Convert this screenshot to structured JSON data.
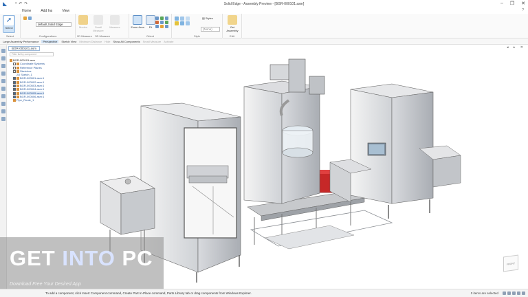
{
  "window": {
    "title": "Solid Edge - Assembly Preview - [BGR-000101.asm]",
    "controls": [
      "–",
      "❐",
      "✕"
    ]
  },
  "menu": {
    "items": [
      "Home",
      "Add Ins",
      "View"
    ],
    "help": "?"
  },
  "ribbon": {
    "select": {
      "label": "Select",
      "group": "Select"
    },
    "configurations": {
      "combo_value": "default,Solid Edge",
      "group": "Configurations"
    },
    "measure": {
      "small_label": "Small Measure",
      "measure_label": "Measure",
      "modes_label": "Modes",
      "measure_2d": "2D Measure",
      "measure_3d": "3D Measure",
      "extra_label": ""
    },
    "zoom": {
      "zoom_area": "Zoom Area",
      "fit": "Fit",
      "group": "Orient"
    },
    "style": {
      "styles_label": "Styles",
      "combo_value": "(None)",
      "group": "Style"
    },
    "edit": {
      "get_assembly": "Get Assembly",
      "group": "Edit"
    }
  },
  "cmdbar": {
    "items": [
      {
        "label": "Large Assembly Performance",
        "dim": false,
        "active": false
      },
      {
        "label": "Perspective",
        "dim": false,
        "active": true
      },
      {
        "label": "Sketch View",
        "dim": false,
        "active": false
      },
      {
        "label": "Minimum Distance",
        "dim": true,
        "active": false
      },
      {
        "label": "Hide",
        "dim": true,
        "active": false
      },
      {
        "label": "Show All Components",
        "dim": false,
        "active": false
      },
      {
        "label": "Small Measure",
        "dim": true,
        "active": false
      },
      {
        "label": "Activate",
        "dim": true,
        "active": false
      }
    ]
  },
  "doc": {
    "tab": "BGR-000101.asm",
    "filter_placeholder": "Filter list by component"
  },
  "tree": [
    {
      "label": "BGR-000101.asm",
      "cb": false,
      "icon": true,
      "style": "plain",
      "indent": 0
    },
    {
      "label": "Coordinate Systems",
      "cb": true,
      "icon": true,
      "style": "link",
      "indent": 1
    },
    {
      "label": "Reference Planes",
      "cb": true,
      "icon": true,
      "style": "link",
      "indent": 1
    },
    {
      "label": "Sketches",
      "cb": true,
      "icon": true,
      "style": "link",
      "indent": 1
    },
    {
      "label": "2D Sketch_1",
      "cb": false,
      "icon": false,
      "style": "link",
      "indent": 2
    },
    {
      "label": "BGR-000501.asm:1",
      "cb": true,
      "on": true,
      "icon": true,
      "style": "link",
      "indent": 1
    },
    {
      "label": "BGR-000502.asm:1",
      "cb": true,
      "on": true,
      "icon": true,
      "style": "link",
      "indent": 1
    },
    {
      "label": "BGR-000503.asm:1",
      "cb": true,
      "on": true,
      "icon": true,
      "style": "link",
      "indent": 1
    },
    {
      "label": "BGR-000504.asm:1",
      "cb": true,
      "on": true,
      "icon": true,
      "style": "link",
      "indent": 1
    },
    {
      "label": "BGR-000505.asm:1",
      "cb": true,
      "on": true,
      "icon": true,
      "style": "sel",
      "indent": 1
    },
    {
      "label": "BGR-000506.asm:1",
      "cb": true,
      "on": true,
      "icon": true,
      "style": "link",
      "indent": 1
    },
    {
      "label": "Pipe_Route_1",
      "cb": false,
      "icon": true,
      "style": "link",
      "indent": 1
    }
  ],
  "watermark": {
    "get": "GET ",
    "into": "INTO",
    "pc": " PC",
    "sub": "Download Free Your Desired App"
  },
  "status": {
    "prompt": "To add a component, click Insert Component command, Create Part In-Place command, Parts Library tab or drag components from Windows Explorer.",
    "selected": "0 items are selected"
  },
  "cube_label": "FRONT"
}
